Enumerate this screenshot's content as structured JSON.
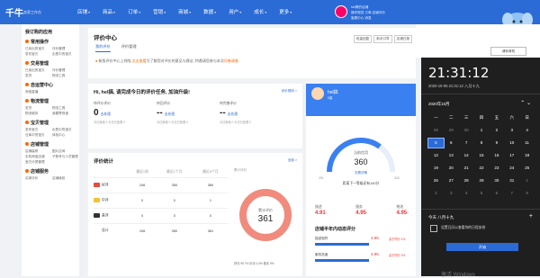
{
  "app": {
    "logo": "千牛",
    "logo_sub": "卖家工作台"
  },
  "nav": [
    "店铺",
    "商品",
    "订单",
    "营销",
    "商城",
    "数据",
    "用户",
    "成长",
    "更多"
  ],
  "user": {
    "line1": "hel搞的店铺",
    "line2": "操作规范 订单 店铺评价",
    "line3": "客服中心 消息"
  },
  "sidebar": {
    "title": "我订购的应用",
    "sections": [
      {
        "title": "常用操作",
        "items": [
          "已卖出的宝贝",
          "评价管理",
          "发布宝贝",
          "出售中的宝贝"
        ]
      },
      {
        "title": "交易管理",
        "items": [
          "已卖出的宝贝",
          "评价管理",
          "发货",
          "物流工具"
        ]
      },
      {
        "title": "自运营中心",
        "items": [
          "淘宝直播"
        ]
      },
      {
        "title": "物流管理",
        "items": [
          "发货",
          "物流工具",
          "物流服务",
          "我要寄快递"
        ]
      },
      {
        "title": "宝贝管理",
        "items": [
          "发布宝贝",
          "出售中的宝贝",
          "仓库中的宝贝",
          "体检中心"
        ]
      },
      {
        "title": "店铺管理",
        "items": [
          "店铺装修",
          "图片空间",
          "手机淘宝店铺",
          "子账号与人员管理",
          "宝贝分类管理"
        ]
      },
      {
        "title": "店铺服务",
        "items": [
          "买家评价",
          "店铺维权"
        ]
      }
    ]
  },
  "page": {
    "title": "评价中心",
    "tabs": [
      "我的评价",
      "评价管理"
    ],
    "active_tab": "我的评价",
    "buttons": [
      "批量回复",
      "新手引导",
      "店铺日报"
    ],
    "notice_pre": "新版评价中心上线啦,",
    "notice_link": "点击查看",
    "notice_post": "为了解您对评价的意见与建议, 特邀请您参与本次",
    "notice_link2": "问卷调查"
  },
  "greeting": {
    "text": "Hi, hel搞, 请完成今日的评价任务, 加油升级!",
    "more": "评价规则 >",
    "stats": [
      {
        "label": "待评价评价",
        "num": "0",
        "link": "去处理",
        "sub": "今日新增 0  今日已处理 0"
      },
      {
        "label": "待回评价",
        "num": "--",
        "link": "去处理",
        "sub": "今日新增 0  今日已处理 0"
      },
      {
        "label": "待完善评价",
        "num": "--",
        "link": "去处理",
        "sub": "今日新增 0  今日已处理 0"
      }
    ]
  },
  "review_stats": {
    "title": "评价统计",
    "more": "全部 >",
    "headers": [
      "",
      "最近1周",
      "最近1个月",
      "最近6个月"
    ],
    "rows": [
      {
        "label": "好评",
        "color": "#e74c3c",
        "values": [
          "106",
          "350",
          "360"
        ]
      },
      {
        "label": "中评",
        "color": "#f5c22e",
        "values": [
          "0",
          "0",
          "1"
        ]
      },
      {
        "label": "差评",
        "color": "#2d3436",
        "values": [
          "0",
          "0",
          "0"
        ]
      },
      {
        "label": "总计",
        "color": "",
        "values": [
          "106",
          "350",
          "361"
        ]
      }
    ],
    "donut_label": "累计评价",
    "donut_total": "361",
    "legend": "好评 99.7%  中评 0.3%  差评 0%"
  },
  "store": {
    "name": "hel搞",
    "level": "5星",
    "gauge_label": "当前信用",
    "gauge_value": "360",
    "gauge_min": "251",
    "gauge_max": "500",
    "gauge_link": "去看详情",
    "upgrade": "距离下一等级还有140分",
    "scores": [
      {
        "label": "描述",
        "value": "4.91",
        "trend": "+"
      },
      {
        "label": "服务",
        "value": "4.95",
        "trend": "+"
      },
      {
        "label": "物流",
        "value": "4.95",
        "trend": "+"
      }
    ],
    "dynamic_title": "店铺半年内动态评分",
    "dynamic_rows": [
      {
        "label": "描述相符",
        "value": "4.95",
        "tag": "高于同行 1%"
      },
      {
        "label": "服务态度",
        "value": "4.95",
        "tag": "高于同行 2%"
      }
    ]
  },
  "widget": {
    "bubble": "请你呀机",
    "online": "在线"
  },
  "clock": {
    "time": "21:31:12",
    "date": "2020-10-05 21:31:12 八月十九",
    "month": "2020年10月",
    "weekdays": [
      "一",
      "二",
      "三",
      "四",
      "五",
      "六",
      "日"
    ],
    "days": [
      "28",
      "29",
      "30",
      "1",
      "2",
      "3",
      "4",
      "5",
      "6",
      "7",
      "8",
      "9",
      "10",
      "11",
      "12",
      "13",
      "14",
      "15",
      "16",
      "17",
      "18",
      "19",
      "20",
      "21",
      "22",
      "23",
      "24",
      "25",
      "26",
      "27",
      "28",
      "29",
      "30",
      "31",
      "1",
      "2",
      "3",
      "4",
      "5",
      "6",
      "7",
      "8"
    ],
    "agenda_title": "今天 八月十九",
    "event": "设置日历以查看你的日程安排",
    "start_button": "开始",
    "watermark": "激活 Windows"
  }
}
